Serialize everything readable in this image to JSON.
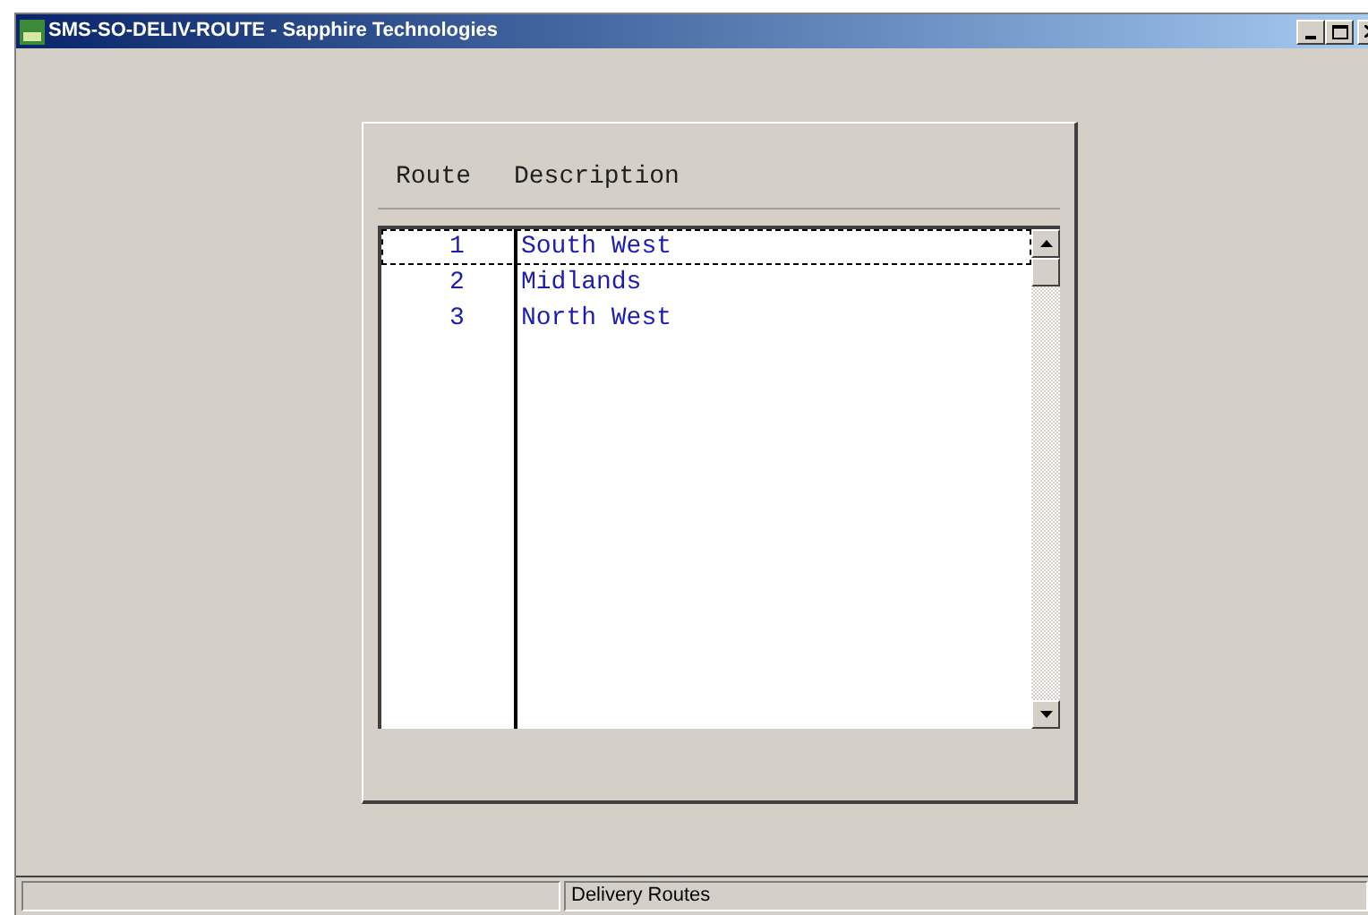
{
  "window": {
    "title": "SMS-SO-DELIV-ROUTE - Sapphire Technologies"
  },
  "table": {
    "columns": [
      "Route",
      "Description"
    ],
    "rows": [
      {
        "route": "1",
        "description": "South West",
        "selected": true
      },
      {
        "route": "2",
        "description": "Midlands",
        "selected": false
      },
      {
        "route": "3",
        "description": "North West",
        "selected": false
      }
    ]
  },
  "status_bar": {
    "message": "Delivery Routes"
  }
}
